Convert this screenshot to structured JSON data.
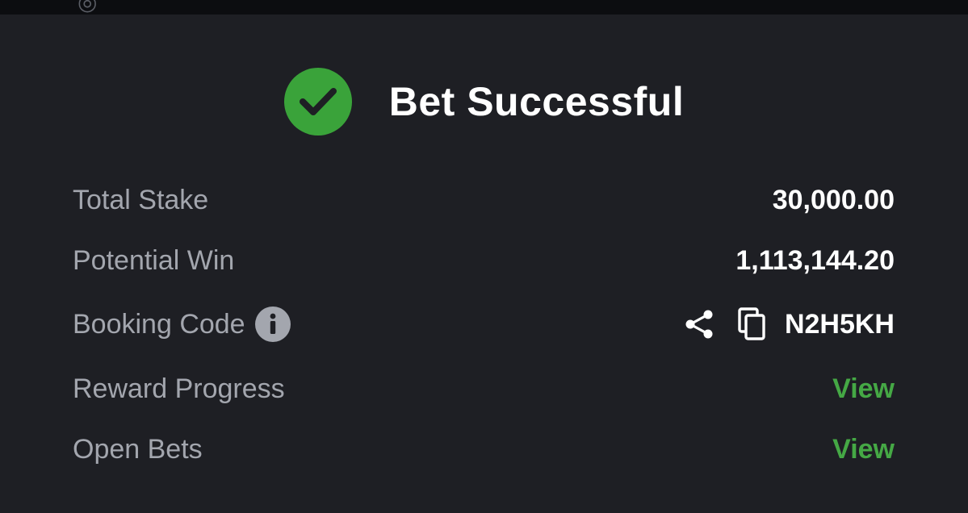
{
  "header": {
    "title": "Bet Successful",
    "icon": "check-circle-icon",
    "accent_color": "#3aa33a"
  },
  "details": {
    "total_stake": {
      "label": "Total Stake",
      "value": "30,000.00"
    },
    "potential_win": {
      "label": "Potential Win",
      "value": "1,113,144.20"
    },
    "booking_code": {
      "label": "Booking Code",
      "value": "N2H5KH",
      "icons": [
        "info-icon",
        "share-icon",
        "copy-icon"
      ]
    },
    "reward_progress": {
      "label": "Reward Progress",
      "action": "View"
    },
    "open_bets": {
      "label": "Open Bets",
      "action": "View"
    }
  },
  "colors": {
    "background": "#1e1f24",
    "label": "#a3a6ae",
    "value": "#ffffff",
    "link": "#45a845"
  }
}
